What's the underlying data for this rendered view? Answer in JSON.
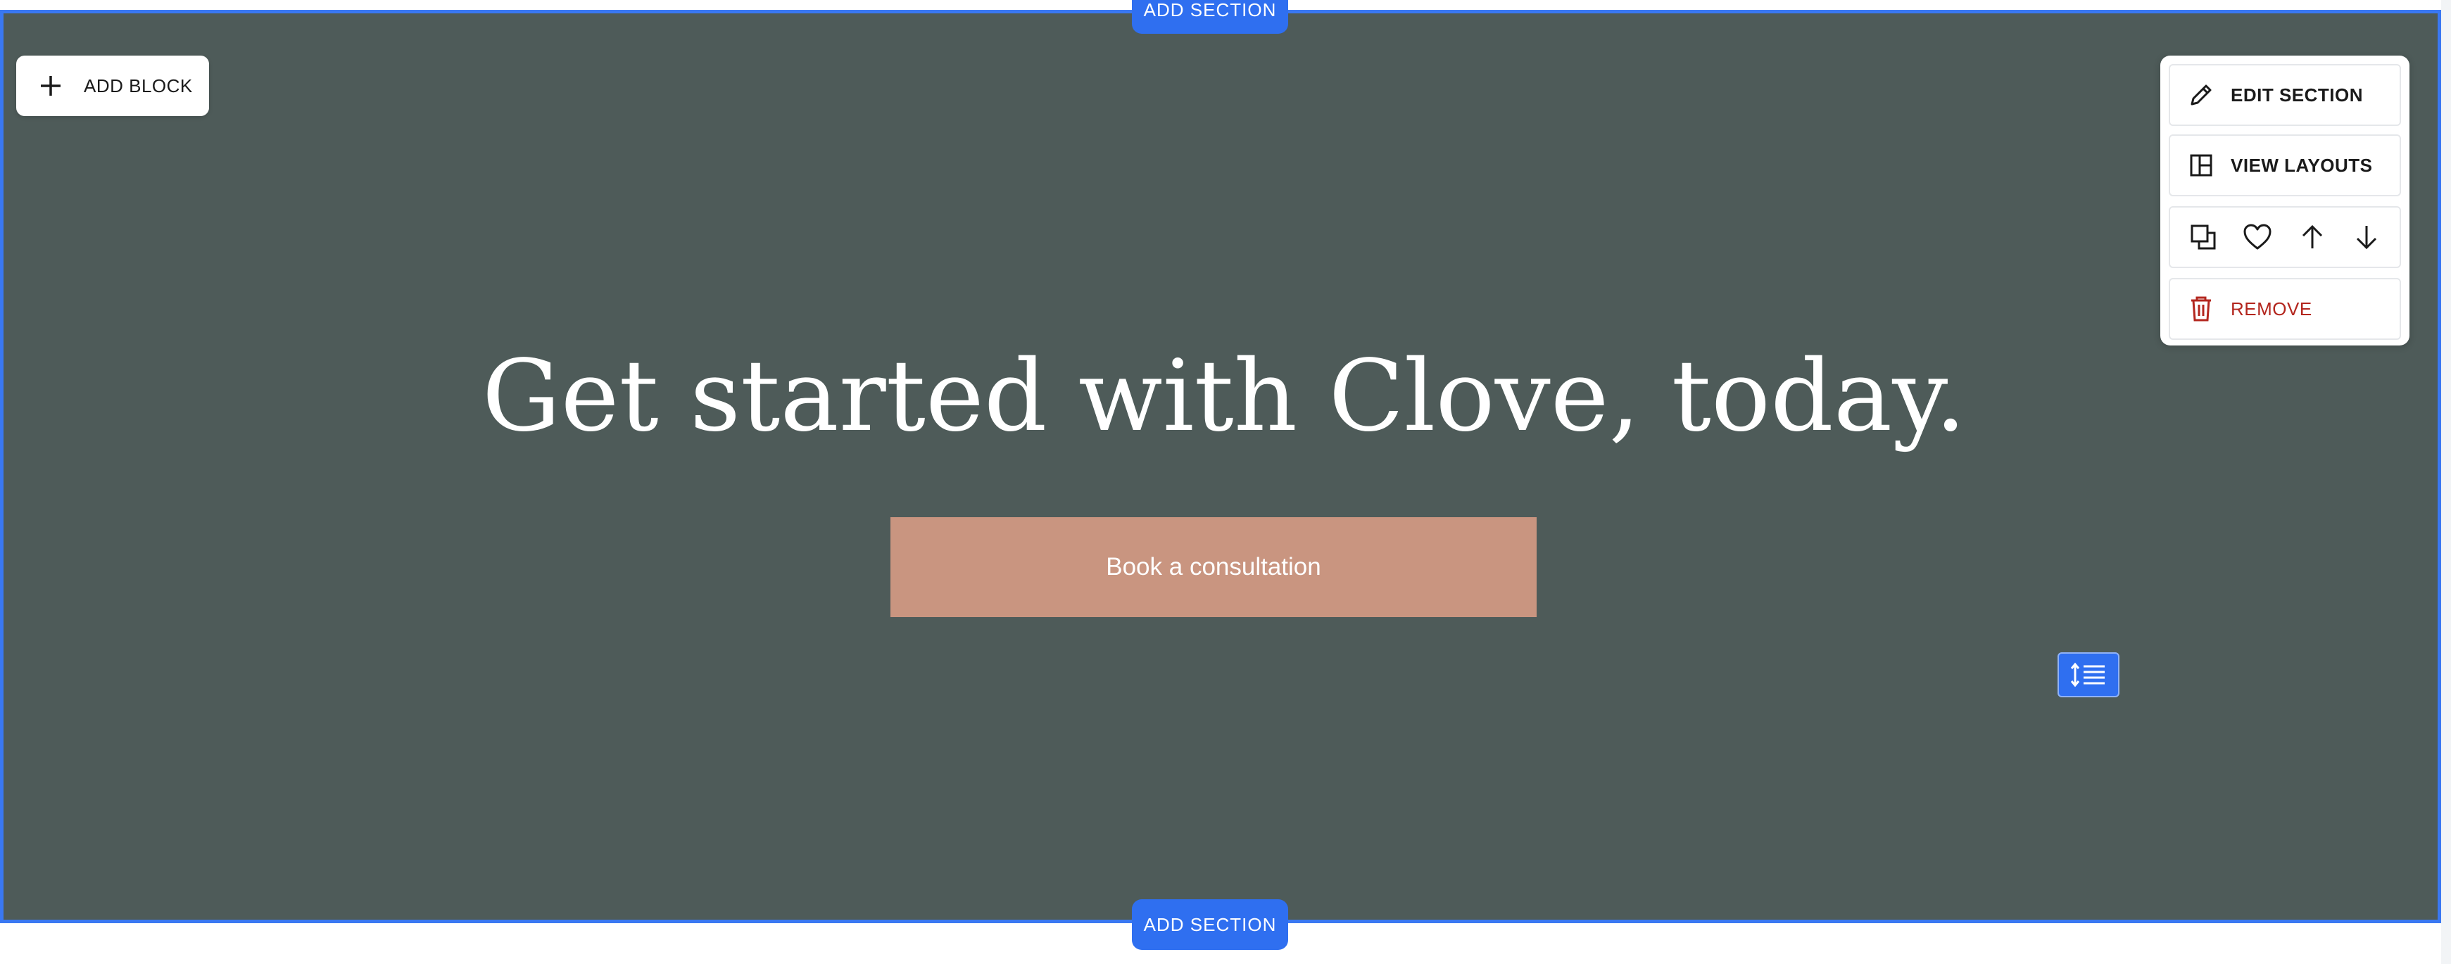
{
  "editor": {
    "add_section_top": "ADD SECTION",
    "add_section_bottom": "ADD SECTION",
    "add_block": "ADD BLOCK"
  },
  "section": {
    "headline": "Get started with Clove, today.",
    "cta_label": "Book a consultation",
    "background_color": "#4e5b59",
    "cta_color": "#c99580"
  },
  "panel": {
    "edit_section": "EDIT SECTION",
    "view_layouts": "VIEW LAYOUTS",
    "remove": "REMOVE",
    "icons": [
      "duplicate-icon",
      "heart-icon",
      "arrow-up-icon",
      "arrow-down-icon"
    ]
  },
  "colors": {
    "accent": "#2f6ff0",
    "danger": "#b3261e"
  }
}
